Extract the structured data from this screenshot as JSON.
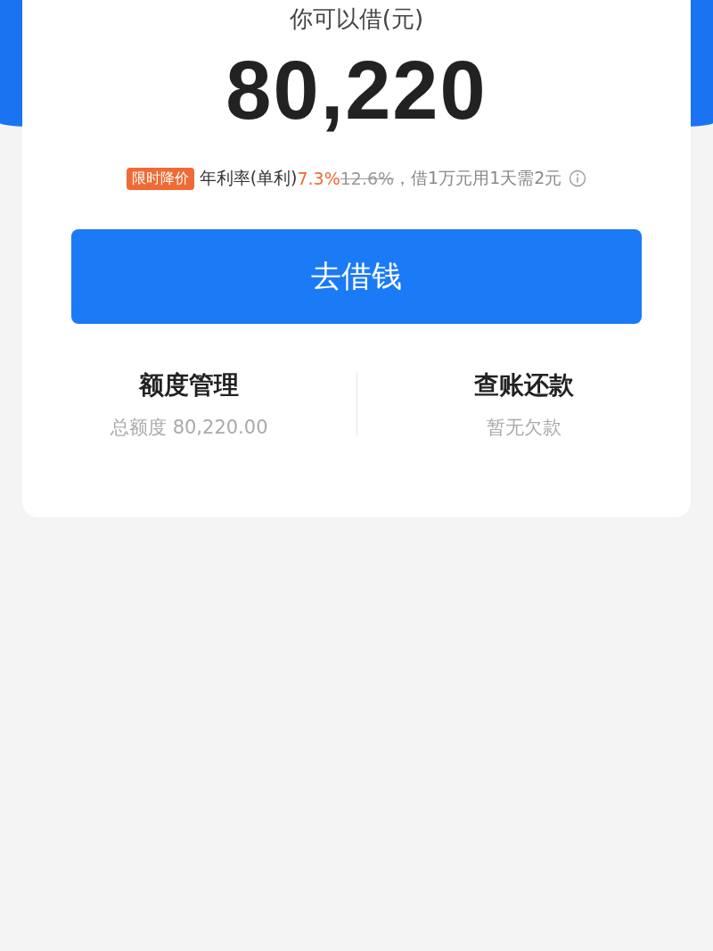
{
  "card": {
    "heading": "你可以借(元)",
    "amount": "80,220",
    "rate": {
      "tag": "限时降价",
      "label": "年利率(单利)",
      "value": "7.3%",
      "old_value": "12.6%",
      "note": "，借1万元用1天需2元"
    },
    "button": "去借钱",
    "actions": [
      {
        "title": "额度管理",
        "subtitle": "总额度 80,220.00"
      },
      {
        "title": "查账还款",
        "subtitle": "暂无欠款"
      }
    ]
  }
}
